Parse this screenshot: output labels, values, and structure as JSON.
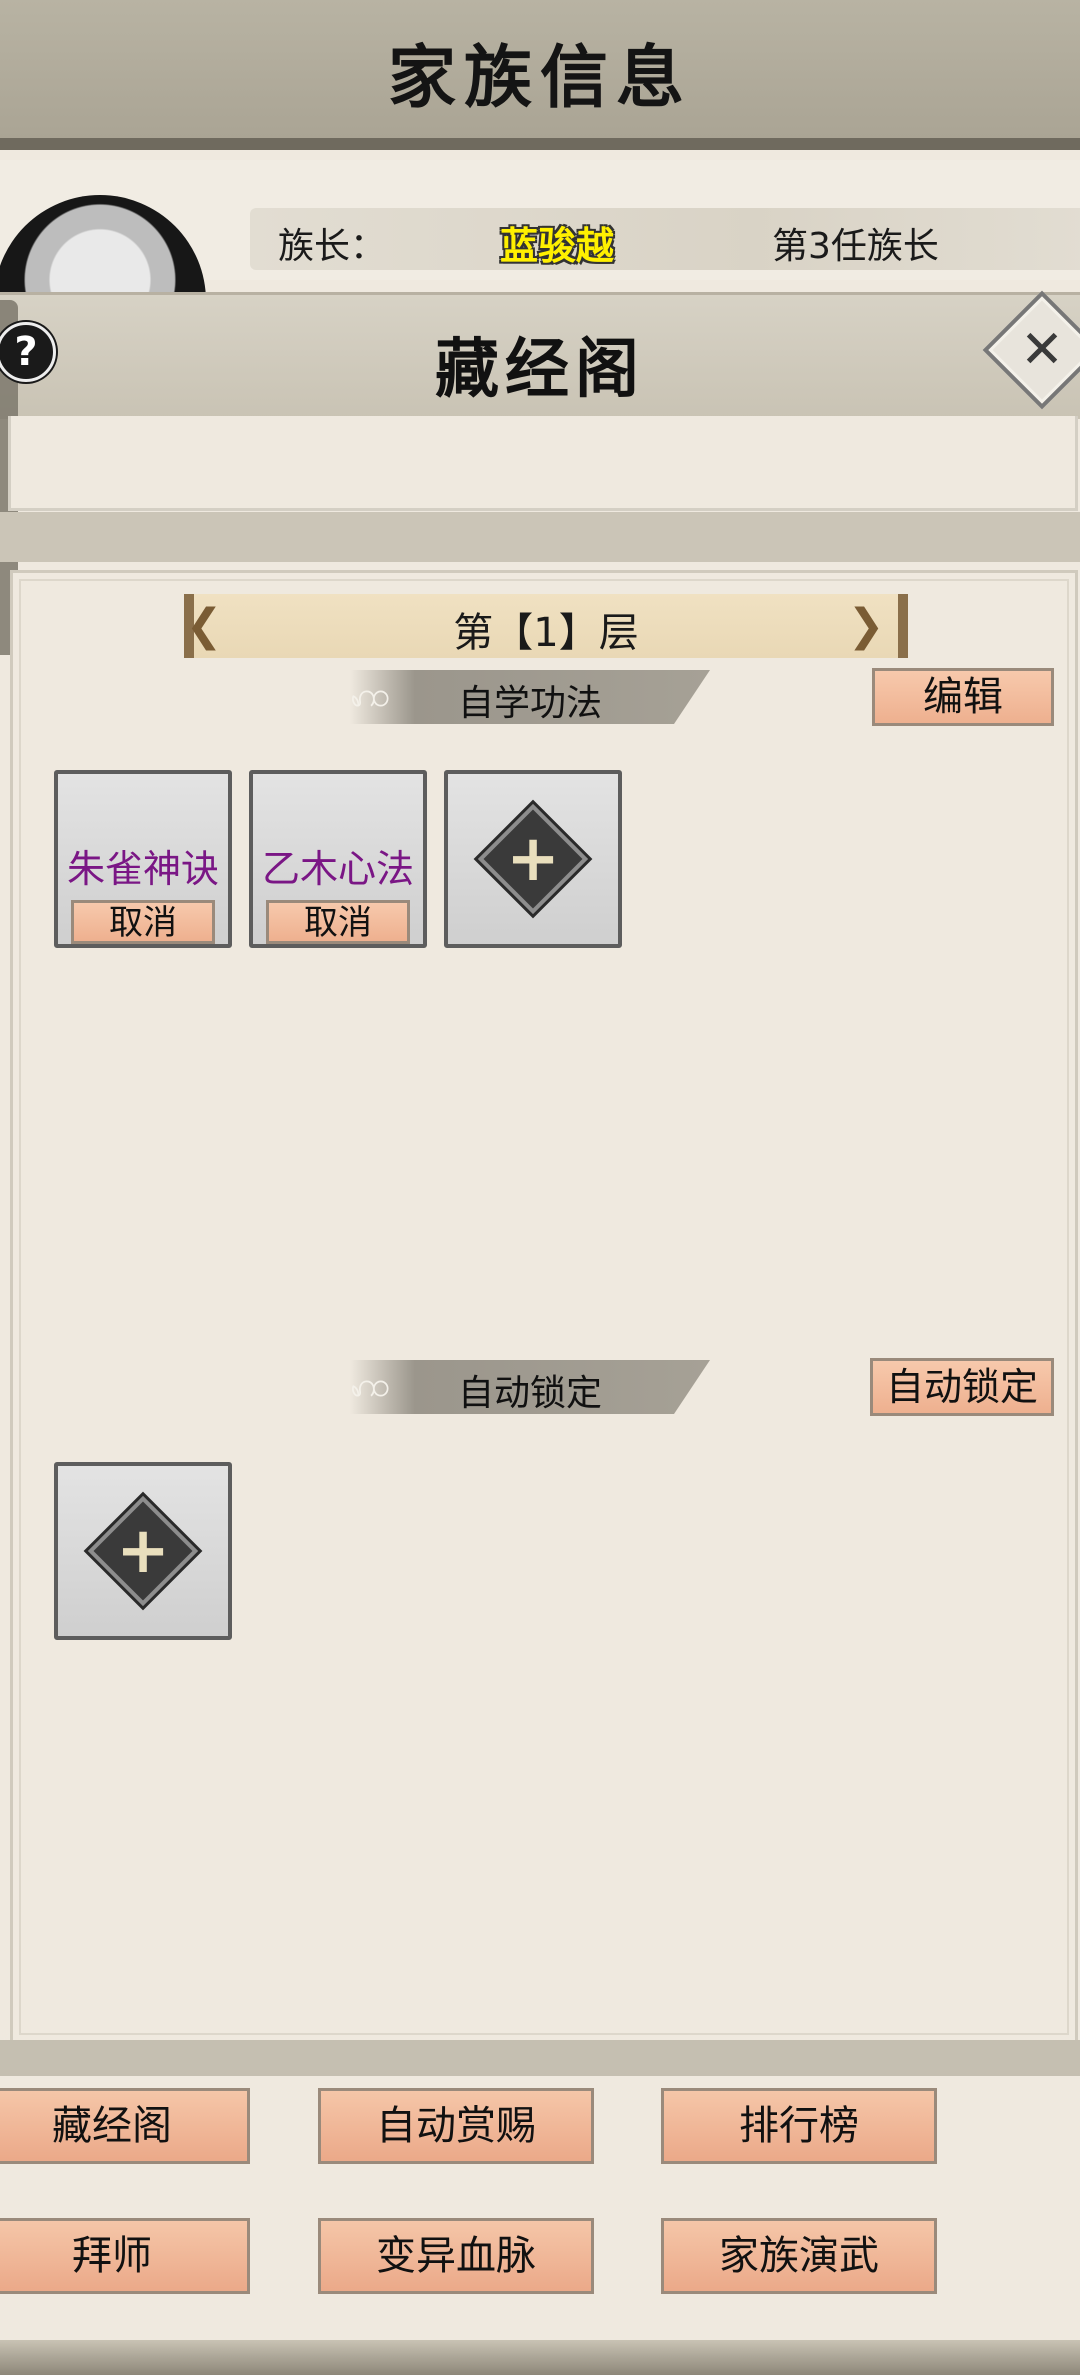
{
  "header": {
    "title": "家族信息"
  },
  "leader": {
    "label": "族长：",
    "name": "蓝骏越",
    "rank": "第3任族长"
  },
  "library": {
    "title": "藏经阁",
    "help_symbol": "?",
    "close_symbol": "✕",
    "floor": {
      "label": "第【1】层",
      "prev_symbol": "❮",
      "next_symbol": "❯"
    },
    "self_study": {
      "section_label": "自学功法",
      "edit_label": "编辑",
      "slots": [
        {
          "name": "朱雀神诀",
          "cancel_label": "取消"
        },
        {
          "name": "乙木心法",
          "cancel_label": "取消"
        }
      ],
      "add_symbol": "+"
    },
    "auto_lock": {
      "section_label": "自动锁定",
      "button_label": "自动锁定",
      "add_symbol": "+"
    },
    "cloud_symbol": "ꩲ"
  },
  "nav": {
    "row1": [
      "藏经阁",
      "自动赏赐",
      "排行榜"
    ],
    "row2": [
      "拜师",
      "变异血脉",
      "家族演武"
    ]
  },
  "colors": {
    "technique_name": "#7a1685",
    "leader_name": "#fff000",
    "button_fill": "#f2b898"
  }
}
